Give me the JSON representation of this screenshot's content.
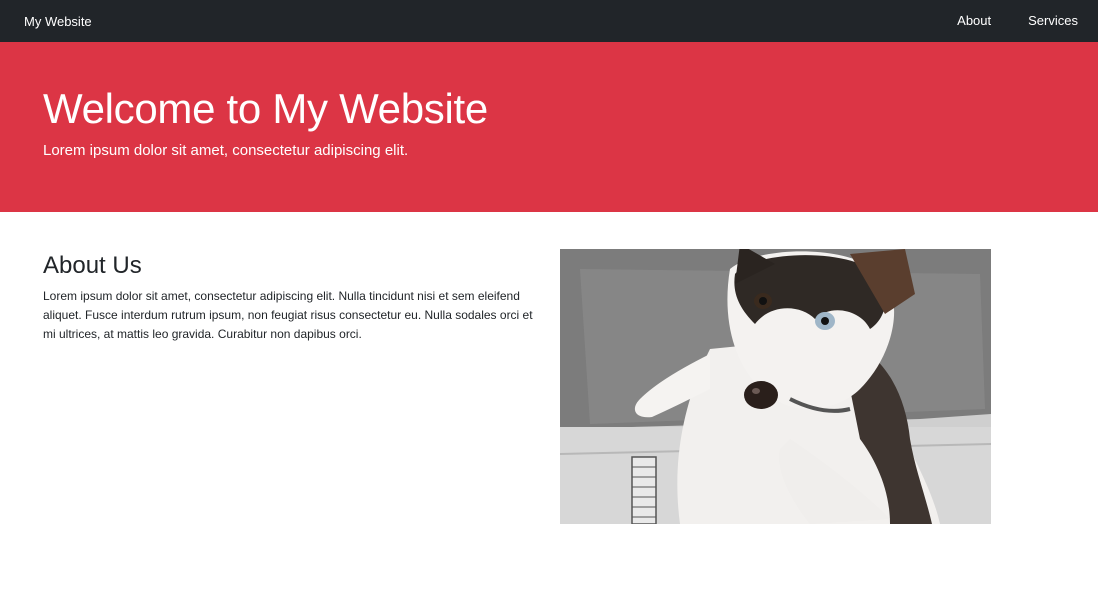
{
  "navbar": {
    "brand": "My Website",
    "links": [
      {
        "label": "About"
      },
      {
        "label": "Services"
      }
    ]
  },
  "hero": {
    "title": "Welcome to My Website",
    "subtitle": "Lorem ipsum dolor sit amet, consectetur adipiscing elit."
  },
  "about": {
    "heading": "About Us",
    "body": "Lorem ipsum dolor sit amet, consectetur adipiscing elit. Nulla tincidunt nisi et sem eleifend aliquet. Fusce interdum rutrum ipsum, non feugiat risus consectetur eu. Nulla sodales orci et mi ultrices, at mattis leo gravida. Curabitur non dapibus orci."
  },
  "image": {
    "subject": "husky-puppy-photo"
  },
  "colors": {
    "navbar_bg": "#212529",
    "hero_bg": "#dc3545",
    "text": "#212529"
  }
}
